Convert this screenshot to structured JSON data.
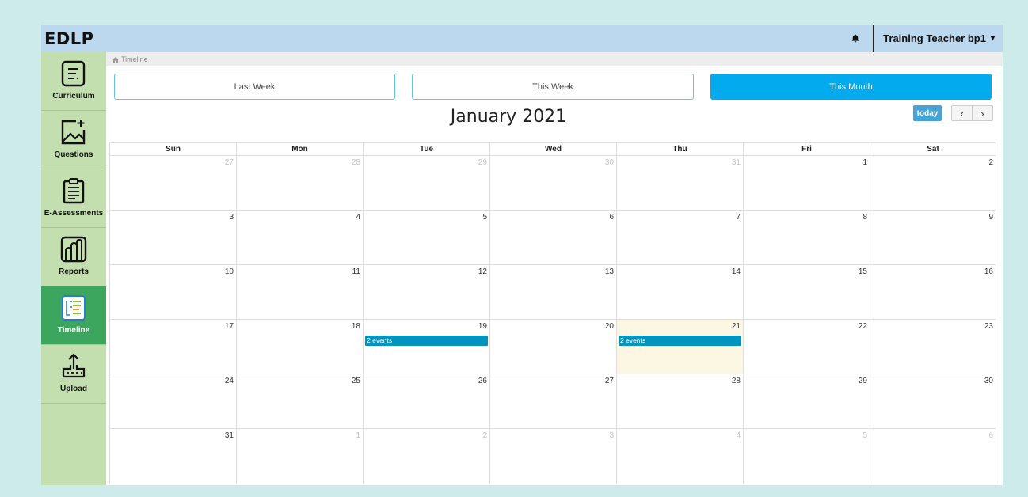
{
  "app": {
    "logo": "EDLP"
  },
  "header": {
    "user_name": "Training Teacher bp1",
    "caret": "▾"
  },
  "breadcrumb": {
    "icon": "home-icon",
    "label": "Timeline"
  },
  "sidebar": {
    "items": [
      {
        "label": "Curriculum",
        "icon": "curriculum-icon"
      },
      {
        "label": "Questions",
        "icon": "questions-icon"
      },
      {
        "label": "E-Assessments",
        "icon": "assessments-icon"
      },
      {
        "label": "Reports",
        "icon": "reports-icon"
      },
      {
        "label": "Timeline",
        "icon": "timeline-icon",
        "active": true
      },
      {
        "label": "Upload",
        "icon": "upload-icon"
      }
    ]
  },
  "range_buttons": {
    "last_week": "Last Week",
    "this_week": "This Week",
    "this_month": "This Month",
    "active": "this_month"
  },
  "calendar": {
    "title": "January 2021",
    "today_label": "today",
    "prev_label": "‹",
    "next_label": "›",
    "weekdays": [
      "Sun",
      "Mon",
      "Tue",
      "Wed",
      "Thu",
      "Fri",
      "Sat"
    ],
    "weeks": [
      [
        {
          "day": "27",
          "other": true
        },
        {
          "day": "28",
          "other": true
        },
        {
          "day": "29",
          "other": true
        },
        {
          "day": "30",
          "other": true
        },
        {
          "day": "31",
          "other": true
        },
        {
          "day": "1"
        },
        {
          "day": "2"
        }
      ],
      [
        {
          "day": "3"
        },
        {
          "day": "4"
        },
        {
          "day": "5"
        },
        {
          "day": "6"
        },
        {
          "day": "7"
        },
        {
          "day": "8"
        },
        {
          "day": "9"
        }
      ],
      [
        {
          "day": "10"
        },
        {
          "day": "11"
        },
        {
          "day": "12"
        },
        {
          "day": "13"
        },
        {
          "day": "14"
        },
        {
          "day": "15"
        },
        {
          "day": "16"
        }
      ],
      [
        {
          "day": "17"
        },
        {
          "day": "18"
        },
        {
          "day": "19",
          "event": "2 events"
        },
        {
          "day": "20"
        },
        {
          "day": "21",
          "event": "2 events",
          "today": true
        },
        {
          "day": "22"
        },
        {
          "day": "23"
        }
      ],
      [
        {
          "day": "24"
        },
        {
          "day": "25"
        },
        {
          "day": "26"
        },
        {
          "day": "27"
        },
        {
          "day": "28"
        },
        {
          "day": "29"
        },
        {
          "day": "30"
        }
      ],
      [
        {
          "day": "31"
        },
        {
          "day": "1",
          "other": true
        },
        {
          "day": "2",
          "other": true
        },
        {
          "day": "3",
          "other": true
        },
        {
          "day": "4",
          "other": true
        },
        {
          "day": "5",
          "other": true
        },
        {
          "day": "6",
          "other": true
        }
      ]
    ]
  },
  "colors": {
    "accent": "#04aaee",
    "sidebar": "#c4dfaf",
    "sidebar_active": "#3ca55e",
    "topbar": "#bcd8ee",
    "event": "#0095bf",
    "today_bg": "#fcf7e3"
  }
}
